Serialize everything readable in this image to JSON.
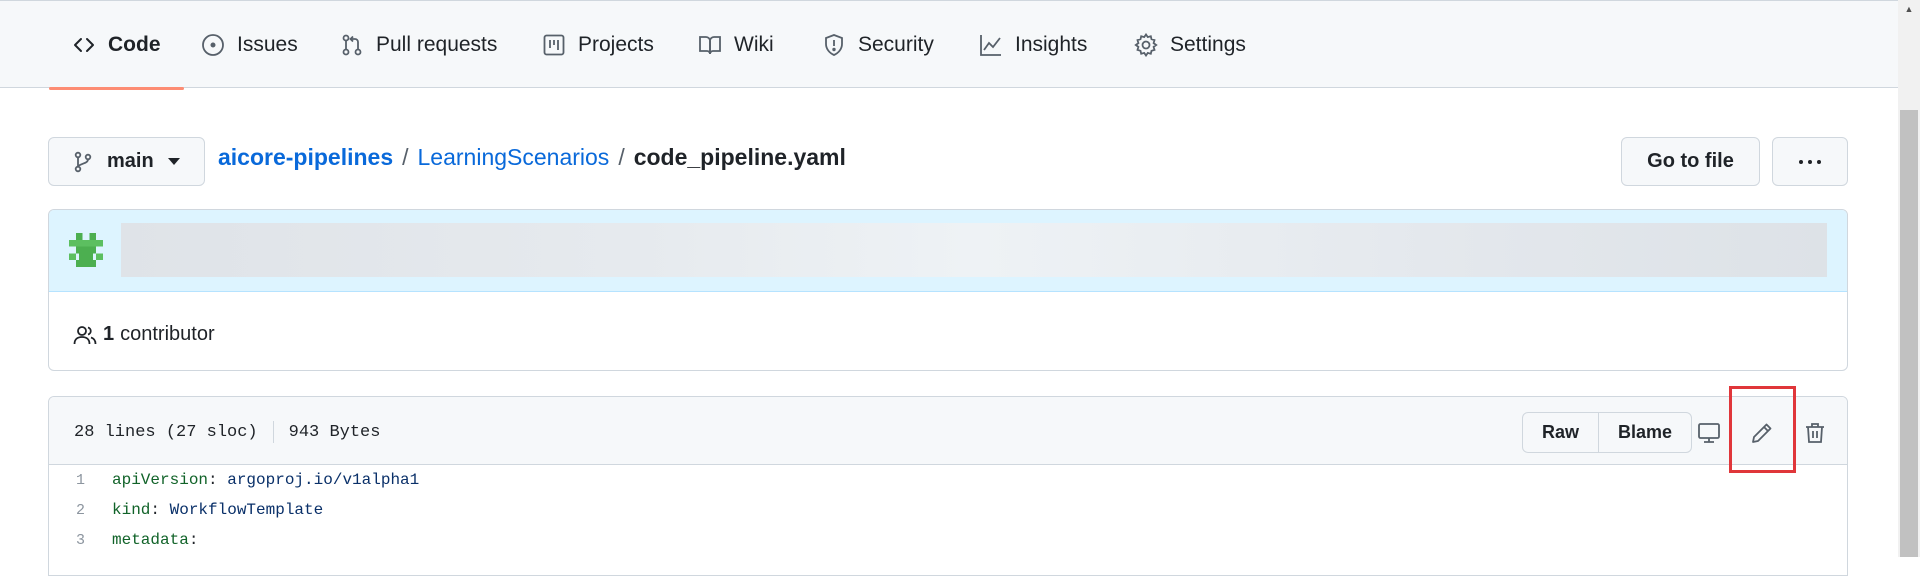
{
  "nav": {
    "tabs": [
      {
        "label": "Code",
        "icon": "code-icon"
      },
      {
        "label": "Issues",
        "icon": "issue-opened-icon"
      },
      {
        "label": "Pull requests",
        "icon": "git-pull-request-icon"
      },
      {
        "label": "Projects",
        "icon": "project-table-icon"
      },
      {
        "label": "Wiki",
        "icon": "book-icon"
      },
      {
        "label": "Security",
        "icon": "shield-icon"
      },
      {
        "label": "Insights",
        "icon": "graph-icon"
      },
      {
        "label": "Settings",
        "icon": "gear-icon"
      }
    ],
    "active_tab": "Code",
    "accent_color": "#fd8c73"
  },
  "repo_bar": {
    "branch": "main",
    "breadcrumb": {
      "repo": "aicore-pipelines",
      "folder": "LearningScenarios",
      "file": "code_pipeline.yaml",
      "separator": "/"
    },
    "go_to_file": "Go to file"
  },
  "commit": {
    "contributors_count": "1",
    "contributors_label": "contributor"
  },
  "file": {
    "lines_info": "28 lines (27 sloc)",
    "size": "943 Bytes",
    "actions": {
      "raw": "Raw",
      "blame": "Blame"
    },
    "highlighted_action": "edit-pencil",
    "highlight_color": "#e0363a",
    "code": [
      {
        "n": "1",
        "key": "apiVersion",
        "value": "argoproj.io/v1alpha1"
      },
      {
        "n": "2",
        "key": "kind",
        "value": "WorkflowTemplate"
      },
      {
        "n": "3",
        "key": "metadata",
        "value": ""
      }
    ]
  },
  "colors": {
    "link": "#0969da",
    "commit_bg": "#ddf4ff",
    "code_key": "#116329",
    "code_value": "#0a3069"
  }
}
